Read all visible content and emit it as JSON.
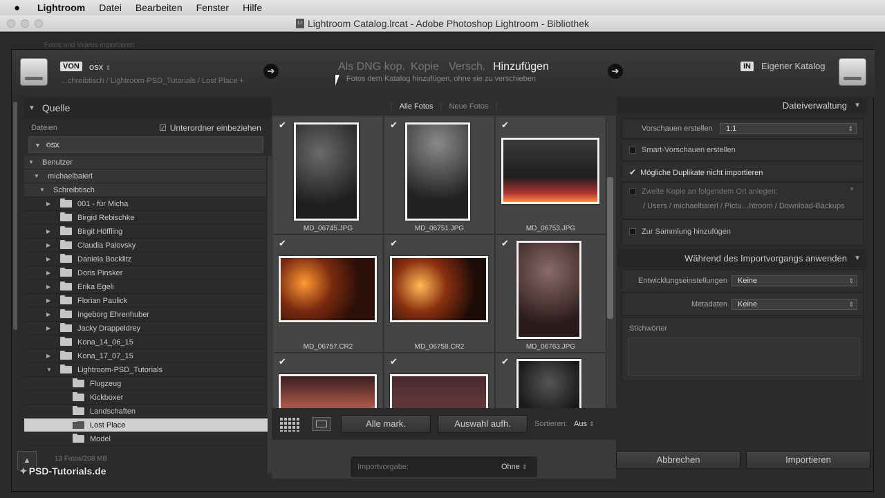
{
  "menubar": {
    "app": "Lightroom",
    "items": [
      "Datei",
      "Bearbeiten",
      "Fenster",
      "Hilfe"
    ]
  },
  "window": {
    "title": "Lightroom Catalog.lrcat - Adobe Photoshop Lightroom - Bibliothek",
    "doc_icon": "Lr"
  },
  "background_text": "Fotos und Videos importieren",
  "header": {
    "from_tag": "VON",
    "source": "osx",
    "path": "…chreibtisch / Lightroom-PSD_Tutorials / Lost Place +",
    "modes": [
      "Als DNG kop.",
      "Kopie",
      "Versch.",
      "Hinzufügen"
    ],
    "active_mode": "Hinzufügen",
    "mode_description": "Fotos dem Katalog hinzufügen, ohne sie zu verschieben",
    "to_tag": "IN",
    "destination": "Eigener Katalog"
  },
  "left_panel": {
    "title": "Quelle",
    "files_label": "Dateien",
    "subfolder_label": "Unterordner einbeziehen",
    "volume": "osx",
    "tree": [
      {
        "label": "Benutzer",
        "icon": "triangle-down"
      },
      {
        "label": "michaelbaierl",
        "icon": "triangle-down"
      },
      {
        "label": "Schreibtisch",
        "icon": "triangle-down"
      },
      {
        "label": "001 - für Micha",
        "icon": "triangle-right"
      },
      {
        "label": "Birgid Rebischke",
        "icon": "none"
      },
      {
        "label": "Birgit Höffling",
        "icon": "triangle-right"
      },
      {
        "label": "Claudia Palovsky",
        "icon": "triangle-right"
      },
      {
        "label": "Daniela Bocklitz",
        "icon": "triangle-right"
      },
      {
        "label": "Doris Pinsker",
        "icon": "triangle-right"
      },
      {
        "label": "Erika Egeli",
        "icon": "triangle-right"
      },
      {
        "label": "Florian Paulick",
        "icon": "triangle-right"
      },
      {
        "label": "Ingeborg Ehrenhuber",
        "icon": "triangle-right"
      },
      {
        "label": "Jacky Drappeldrey",
        "icon": "triangle-right"
      },
      {
        "label": "Kona_14_06_15",
        "icon": "none"
      },
      {
        "label": "Kona_17_07_15",
        "icon": "triangle-right"
      },
      {
        "label": "Lightroom-PSD_Tutorials",
        "icon": "triangle-down"
      },
      {
        "label": "Flugzeug",
        "icon": "none"
      },
      {
        "label": "Kickboxer",
        "icon": "none"
      },
      {
        "label": "Landschaften",
        "icon": "none"
      },
      {
        "label": "Lost Place",
        "icon": "none",
        "selected": true
      },
      {
        "label": "Model",
        "icon": "none"
      }
    ],
    "status": "13 Fotos/208 MB"
  },
  "grid": {
    "tabs": [
      "Alle Fotos",
      "Neue Fotos"
    ],
    "files": [
      "MD_06745.JPG",
      "MD_06751.JPG",
      "MD_06753.JPG",
      "MD_06757.CR2",
      "MD_06758.CR2",
      "MD_06763.JPG"
    ],
    "select_all": "Alle mark.",
    "deselect": "Auswahl aufh.",
    "sort_label": "Sortieren:",
    "sort_value": "Aus"
  },
  "right_panel": {
    "file_handling": "Dateiverwaltung",
    "previews_label": "Vorschauen erstellen",
    "previews_value": "1:1",
    "smart_previews": "Smart-Vorschauen erstellen",
    "no_duplicates": "Mögliche Duplikate nicht importieren",
    "second_copy": "Zweite Kopie an folgendem Ort anlegen:",
    "second_copy_path": "/ Users / michaelbaierl / Pictu…htroom / Download-Backups",
    "add_to_collection": "Zur Sammlung hinzufügen",
    "apply_during": "Während des Importvorgangs anwenden",
    "develop_label": "Entwicklungseinstellungen",
    "develop_value": "Keine",
    "metadata_label": "Metadaten",
    "metadata_value": "Keine",
    "keywords_label": "Stichwörter"
  },
  "footer": {
    "preset_label": "Importvorgabe:",
    "preset_value": "Ohne",
    "cancel": "Abbrechen",
    "import": "Importieren",
    "watermark": "PSD-Tutorials.de"
  }
}
